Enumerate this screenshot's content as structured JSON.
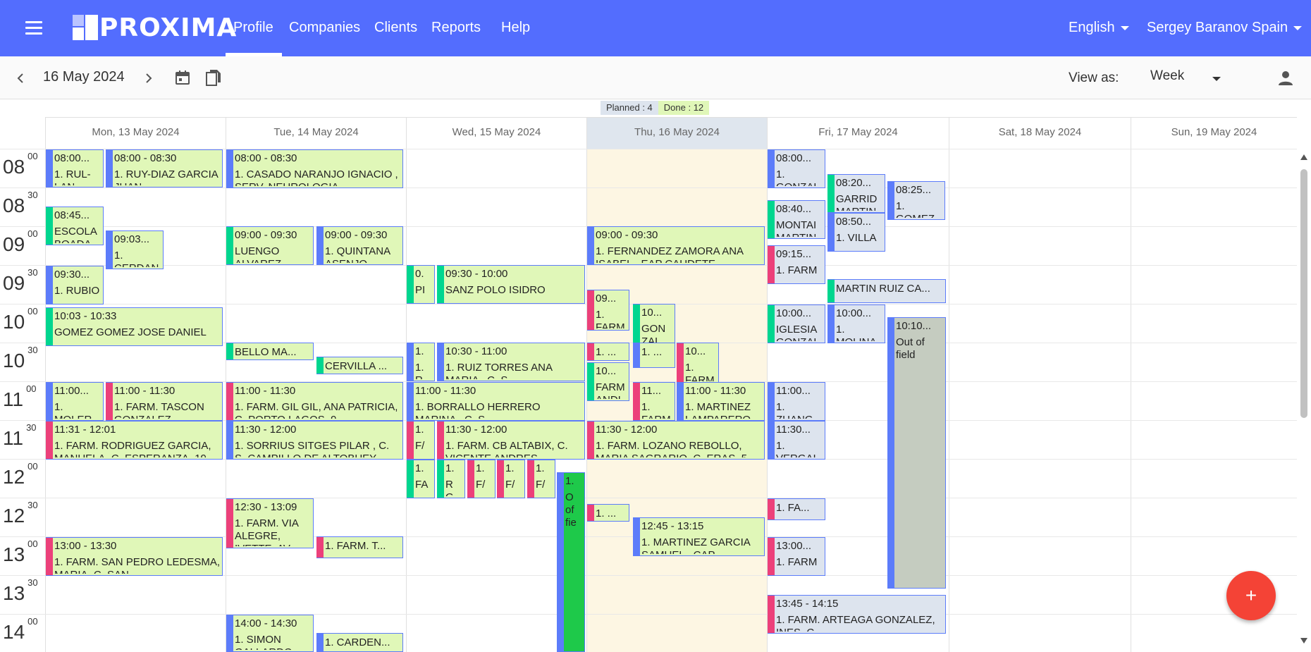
{
  "app": {
    "name": "PROXIMA"
  },
  "nav": {
    "profile": "Profile",
    "companies": "Companies",
    "clients": "Clients",
    "reports": "Reports",
    "help": "Help"
  },
  "language": "English",
  "user": "Sergey Baranov Spain",
  "toolbar": {
    "date": "16 May 2024",
    "view_label": "View as:",
    "view_value": "Week"
  },
  "counts": {
    "planned": "Planned : 4",
    "done": "Done : 12"
  },
  "days": [
    "Mon, 13 May 2024",
    "Tue, 14 May 2024",
    "Wed, 15 May 2024",
    "Thu, 16 May 2024",
    "Fri, 17 May 2024",
    "Sat, 18 May 2024",
    "Sun, 19 May 2024"
  ],
  "hours": [
    {
      "h": "08",
      "m": "00"
    },
    {
      "h": "08",
      "m": "30"
    },
    {
      "h": "09",
      "m": "00"
    },
    {
      "h": "09",
      "m": "30"
    },
    {
      "h": "10",
      "m": "00"
    },
    {
      "h": "10",
      "m": "30"
    },
    {
      "h": "11",
      "m": "00"
    },
    {
      "h": "11",
      "m": "30"
    },
    {
      "h": "12",
      "m": "00"
    },
    {
      "h": "12",
      "m": "30"
    },
    {
      "h": "13",
      "m": "00"
    },
    {
      "h": "13",
      "m": "30"
    },
    {
      "h": "14",
      "m": "00"
    }
  ],
  "colors": {
    "header": "#536dfe",
    "done": "#e0f7b8",
    "planned": "#dde4ee",
    "blue": "#5c7cfa",
    "pink": "#ec407a",
    "green": "#00d68f",
    "fab": "#f44336"
  },
  "events": {
    "mon": [
      {
        "t1": "08:00...",
        "t2": "1. RUL-LAN..."
      },
      {
        "t1": "08:00 - 08:30",
        "t2": "1. RUY-DIAZ GARCIA JUAN"
      },
      {
        "t1": "08:45...",
        "t2": "ESCOLA BOADA"
      },
      {
        "t1": "09:03...",
        "t2": "1. CERDAN"
      },
      {
        "t1": "09:30...",
        "t2": "1. RUBIO"
      },
      {
        "t1": "10:03 - 10:33",
        "t2": "GOMEZ GOMEZ JOSE DANIEL"
      },
      {
        "t1": "11:00...",
        "t2": "1. MOLER..."
      },
      {
        "t1": "11:00 - 11:30",
        "t2": "1. FARM. TASCON GONZALEZ"
      },
      {
        "t1": "11:31 - 12:01",
        "t2": "1. FARM. RODRIGUEZ GARCIA, MANUELA, C. ESPERANZA, 19"
      },
      {
        "t1": "13:00 - 13:30",
        "t2": "1. FARM. SAN PEDRO LEDESMA, MARIA, C. SAN..."
      }
    ],
    "tue": [
      {
        "t1": "08:00 - 08:30",
        "t2": "1. CASADO NARANJO IGNACIO , SERV. NEUROLOGIA"
      },
      {
        "t1": "09:00 - 09:30",
        "t2": "LUENGO ALVAREZ"
      },
      {
        "t1": "09:00 - 09:30",
        "t2": "1. QUINTANA ASENJO"
      },
      {
        "t1": "BELLO MA..."
      },
      {
        "t1": "CERVILLA ..."
      },
      {
        "t1": "11:00 - 11:30",
        "t2": "1. FARM. GIL GIL, ANA PATRICIA, C. PORTO LAGOS, 9"
      },
      {
        "t1": "11:30 - 12:00",
        "t2": "1. SORRIUS SITGES PILAR , C. S. CAMPILLO DE ALTOBUEY"
      },
      {
        "t1": "12:30 - 13:09",
        "t2": "1. FARM. VIA ALEGRE, IVETTE, AV..."
      },
      {
        "t1": "1. FARM. T..."
      },
      {
        "t1": "14:00 - 14:30",
        "t2": "1. SIMON GALLARDO"
      },
      {
        "t1": "1. CARDEN..."
      }
    ],
    "wed": [
      {
        "t1": "0.",
        "t2": "PI"
      },
      {
        "t1": "09:30 - 10:00",
        "t2": "SANZ POLO ISIDRO"
      },
      {
        "t1": "1.",
        "t2": "1. R"
      },
      {
        "t1": "10:30 - 11:00",
        "t2": "1. RUIZ TORRES ANA MARIA , C. S..."
      },
      {
        "t1": "11:00 - 11:30",
        "t2": "1. BORRALLO HERRERO MARINA , C. S..."
      },
      {
        "t1": "1.",
        "t2": "F/"
      },
      {
        "t1": "11:30 - 12:00",
        "t2": "1. FARM. CB ALTABIX, C. VICENTE ANDRES..."
      },
      {
        "t1": "1.",
        "t2": "FA"
      },
      {
        "t1": "1.",
        "t2": "R G"
      },
      {
        "t1": "1.",
        "t2": "F/"
      },
      {
        "t1": "1.",
        "t2": "F/"
      },
      {
        "t1": "1.",
        "t2": "F/"
      },
      {
        "t1": "1.",
        "t2": "O of fie"
      }
    ],
    "thu": [
      {
        "t1": "09:00 - 09:30",
        "t2": "1. FERNANDEZ ZAMORA ANA ISABEL , EAP CAUDETE"
      },
      {
        "t1": "09...",
        "t2": "1. FARM"
      },
      {
        "t1": "10...",
        "t2": "GON ZAL"
      },
      {
        "t1": "1. ..."
      },
      {
        "t1": "1. ..."
      },
      {
        "t1": "10...",
        "t2": "1. FARM"
      },
      {
        "t1": "10...",
        "t2": "FARM ANDI"
      },
      {
        "t1": "11...",
        "t2": "1. FARM"
      },
      {
        "t1": "11:00 - 11:30",
        "t2": "1. MARTINEZ LAMPARERO"
      },
      {
        "t1": "11:30 - 12:00",
        "t2": "1. FARM. LOZANO REBOLLO, MARIA SAGRARIO, C. ERAS, 5"
      },
      {
        "t1": "1. ..."
      },
      {
        "t1": "12:45 - 13:15",
        "t2": "1. MARTINEZ GARCIA SAMUEL , CAP..."
      }
    ],
    "fri": [
      {
        "t1": "08:00...",
        "t2": "1. GONZAL"
      },
      {
        "t1": "08:20...",
        "t2": "GARRID MARTIN"
      },
      {
        "t1": "08:25...",
        "t2": "1. GOMEZ"
      },
      {
        "t1": "08:40...",
        "t2": "MONTAI MARTIN"
      },
      {
        "t1": "08:50...",
        "t2": "1. VILLA"
      },
      {
        "t1": "09:15...",
        "t2": "1. FARM"
      },
      {
        "t1": "MARTIN RUIZ CA..."
      },
      {
        "t1": "10:00...",
        "t2": "IGLESIA GONZAL"
      },
      {
        "t1": "10:00...",
        "t2": "1. MOLINA"
      },
      {
        "t1": "10:10...",
        "t2": "Out of field"
      },
      {
        "t1": "11:00...",
        "t2": "1. ZHANG"
      },
      {
        "t1": "11:30...",
        "t2": "1. VERGAI"
      },
      {
        "t1": "1. FA..."
      },
      {
        "t1": "13:00...",
        "t2": "1. FARM"
      },
      {
        "t1": "13:45 - 14:15",
        "t2": "1. FARM. ARTEAGA GONZALEZ, INES, C..."
      }
    ]
  },
  "fab_label": "+"
}
